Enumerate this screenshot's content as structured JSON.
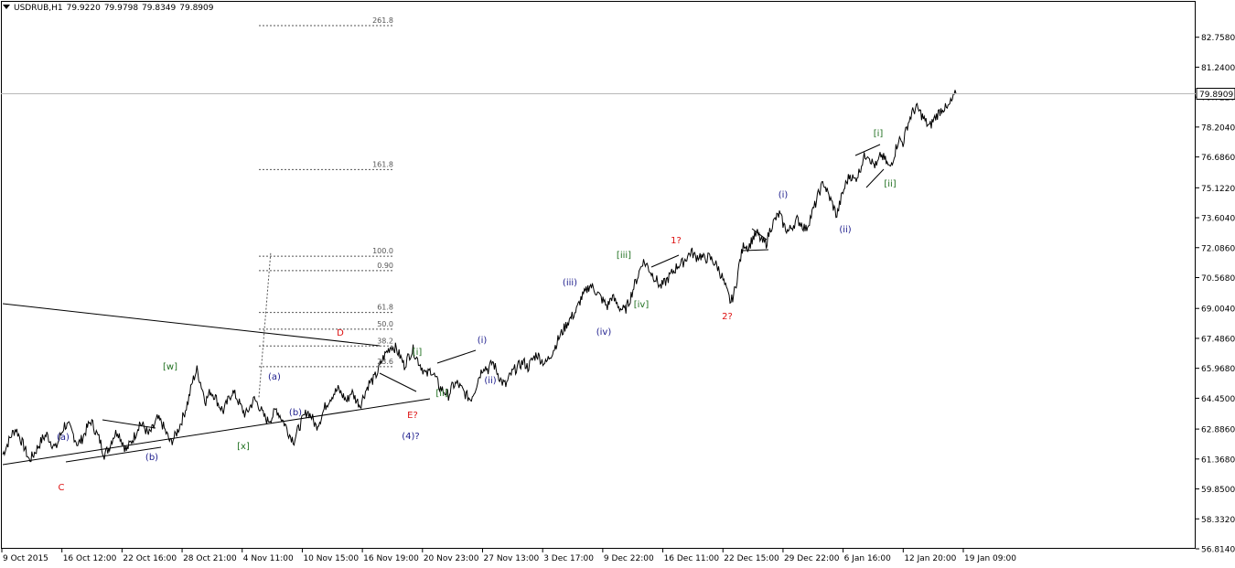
{
  "header": {
    "symbol": "USDRUB,H1",
    "open": "79.9220",
    "high": "79.9798",
    "low": "79.8349",
    "close": "79.8909"
  },
  "chart_data": {
    "type": "line",
    "title": "",
    "xlabel": "",
    "ylabel": "",
    "ylim": [
      56.814,
      84.6
    ],
    "x_ticks": [
      "9 Oct 2015",
      "16 Oct 12:00",
      "22 Oct 16:00",
      "28 Oct 21:00",
      "4 Nov 11:00",
      "10 Nov 15:00",
      "16 Nov 19:00",
      "20 Nov 23:00",
      "27 Nov 13:00",
      "3 Dec 17:00",
      "9 Dec 22:00",
      "16 Dec 11:00",
      "22 Dec 15:00",
      "29 Dec 22:00",
      "6 Jan 16:00",
      "12 Jan 20:00",
      "19 Jan 09:00"
    ],
    "y_ticks": [
      "82.7580",
      "81.2400",
      "79.7220",
      "78.2040",
      "76.6860",
      "75.1220",
      "73.6040",
      "72.0860",
      "70.5680",
      "69.0040",
      "67.4860",
      "65.9680",
      "64.4500",
      "62.8860",
      "61.3680",
      "59.8500",
      "58.3320",
      "56.8140"
    ],
    "current_price": "79.8909",
    "current_value": 79.8909,
    "grid": false,
    "series": [
      {
        "values": [
          61.6,
          62.1,
          62.6,
          62.9,
          62.4,
          61.9,
          61.3,
          61.6,
          62.0,
          62.4,
          62.6,
          62.2,
          61.9,
          62.5,
          63.1,
          63.0,
          62.6,
          62.1,
          62.4,
          62.9,
          63.3,
          62.8,
          62.3,
          61.6,
          61.9,
          62.5,
          62.8,
          62.3,
          61.8,
          62.2,
          62.6,
          63.2,
          63.0,
          62.6,
          62.9,
          63.4,
          63.2,
          62.7,
          62.2,
          62.5,
          63.0,
          63.6,
          64.3,
          65.3,
          65.9,
          65.1,
          64.3,
          64.8,
          64.6,
          64.1,
          63.8,
          64.3,
          64.8,
          64.5,
          64.0,
          63.6,
          64.0,
          64.4,
          64.1,
          63.6,
          63.3,
          63.5,
          63.9,
          63.5,
          63.1,
          62.6,
          62.3,
          62.9,
          63.4,
          63.8,
          63.5,
          63.0,
          63.4,
          64.0,
          64.4,
          64.7,
          64.9,
          64.6,
          64.3,
          64.8,
          64.4,
          64.1,
          64.7,
          65.2,
          65.4,
          65.8,
          66.4,
          66.8,
          67.1,
          67.0,
          66.6,
          66.1,
          66.6,
          66.9,
          66.4,
          66.0,
          65.6,
          65.9,
          65.5,
          65.0,
          64.8,
          64.6,
          65.1,
          65.2,
          64.9,
          64.6,
          64.4,
          64.9,
          65.6,
          66.1,
          65.9,
          66.3,
          65.8,
          65.3,
          65.1,
          65.6,
          65.9,
          66.1,
          66.3,
          66.0,
          66.4,
          66.7,
          66.4,
          66.2,
          66.6,
          67.0,
          67.5,
          67.9,
          68.3,
          68.6,
          68.9,
          69.5,
          69.8,
          70.2,
          70.0,
          69.7,
          69.4,
          69.1,
          69.6,
          69.3,
          69.0,
          68.9,
          69.4,
          70.1,
          70.7,
          71.4,
          71.2,
          70.8,
          70.5,
          70.1,
          70.3,
          70.6,
          70.9,
          71.2,
          71.3,
          71.6,
          71.9,
          71.6,
          71.7,
          71.5,
          71.6,
          71.4,
          71.1,
          70.6,
          69.9,
          69.3,
          70.0,
          71.4,
          72.3,
          72.1,
          72.6,
          72.8,
          72.4,
          72.3,
          73.1,
          73.5,
          73.8,
          73.2,
          72.9,
          73.2,
          73.5,
          73.3,
          73.0,
          73.6,
          74.2,
          74.9,
          75.4,
          74.8,
          74.3,
          73.7,
          74.6,
          75.3,
          75.8,
          75.5,
          75.9,
          76.6,
          76.9,
          76.4,
          76.2,
          76.8,
          76.5,
          76.1,
          76.8,
          77.6,
          77.4,
          78.3,
          78.9,
          79.2,
          78.9,
          78.5,
          78.2,
          78.6,
          78.9,
          79.2,
          79.1,
          79.5,
          79.9
        ]
      }
    ],
    "wave_labels": [
      "C",
      "(a)",
      "(b)",
      "[w]",
      "[x]",
      "(a)",
      "(b)",
      "D",
      "E?",
      "(4)?",
      "[i]",
      "[ii]",
      "(i)",
      "(ii)",
      "(iii)",
      "(iv)",
      "[iii]",
      "[iv]",
      "1?",
      "2?",
      "(i)",
      "(ii)",
      "[i]",
      "[ii]"
    ],
    "fib_levels": [
      {
        "label": "261.8",
        "value": 83.35
      },
      {
        "label": "161.8",
        "value": 76.05
      },
      {
        "label": "100.0",
        "value": 71.65
      },
      {
        "label": "0.90",
        "value": 70.92
      },
      {
        "label": "61.8",
        "value": 68.8
      },
      {
        "label": "50.0",
        "value": 67.95
      },
      {
        "label": "38.2",
        "value": 67.1
      },
      {
        "label": "23.6",
        "value": 66.05
      }
    ]
  },
  "colors": {
    "price": "#000000",
    "wave_blue": "#1c1c8c",
    "wave_green": "#207020",
    "wave_red": "#dd1111",
    "fib": "#555555"
  }
}
